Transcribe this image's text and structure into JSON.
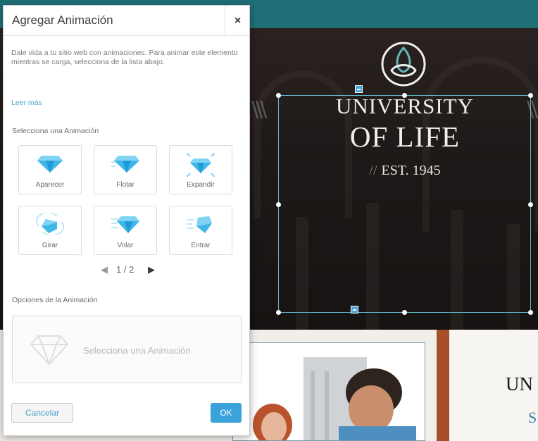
{
  "dialog": {
    "title": "Agregar Animación",
    "close_label": "×",
    "description": "Dale vida a tu sitio web con animaciones. Para animar este elemento mientras se carga, selecciona de la lista abajo.",
    "read_more": "Leer más",
    "select_label": "Selecciona una Animación",
    "animations": [
      {
        "label": "Aparecer",
        "icon": "diamond-appear-icon"
      },
      {
        "label": "Flotar",
        "icon": "diamond-float-icon"
      },
      {
        "label": "Expandir",
        "icon": "diamond-expand-icon"
      },
      {
        "label": "Girar",
        "icon": "diamond-spin-icon"
      },
      {
        "label": "Volar",
        "icon": "diamond-fly-icon"
      },
      {
        "label": "Entrar",
        "icon": "diamond-enter-icon"
      }
    ],
    "pager": {
      "prev": "◀",
      "text": "1 / 2",
      "next": "▶"
    },
    "options_label": "Opciones de la Animación",
    "options_placeholder": "Selecciona una Animación",
    "cancel_label": "Cancelar",
    "ok_label": "OK"
  },
  "site": {
    "title_line1": "UNIVERSITY",
    "title_line2": "OF LIFE",
    "est_slashes": "//",
    "est_text": "EST. 1945",
    "lower_title": "UN",
    "lower_sub": "S"
  },
  "colors": {
    "accent": "#3ba3dc",
    "link": "#4fa5cd",
    "topbar": "#1f6f77",
    "gem": "#3fb6e8",
    "selection": "#5fb8c9"
  }
}
